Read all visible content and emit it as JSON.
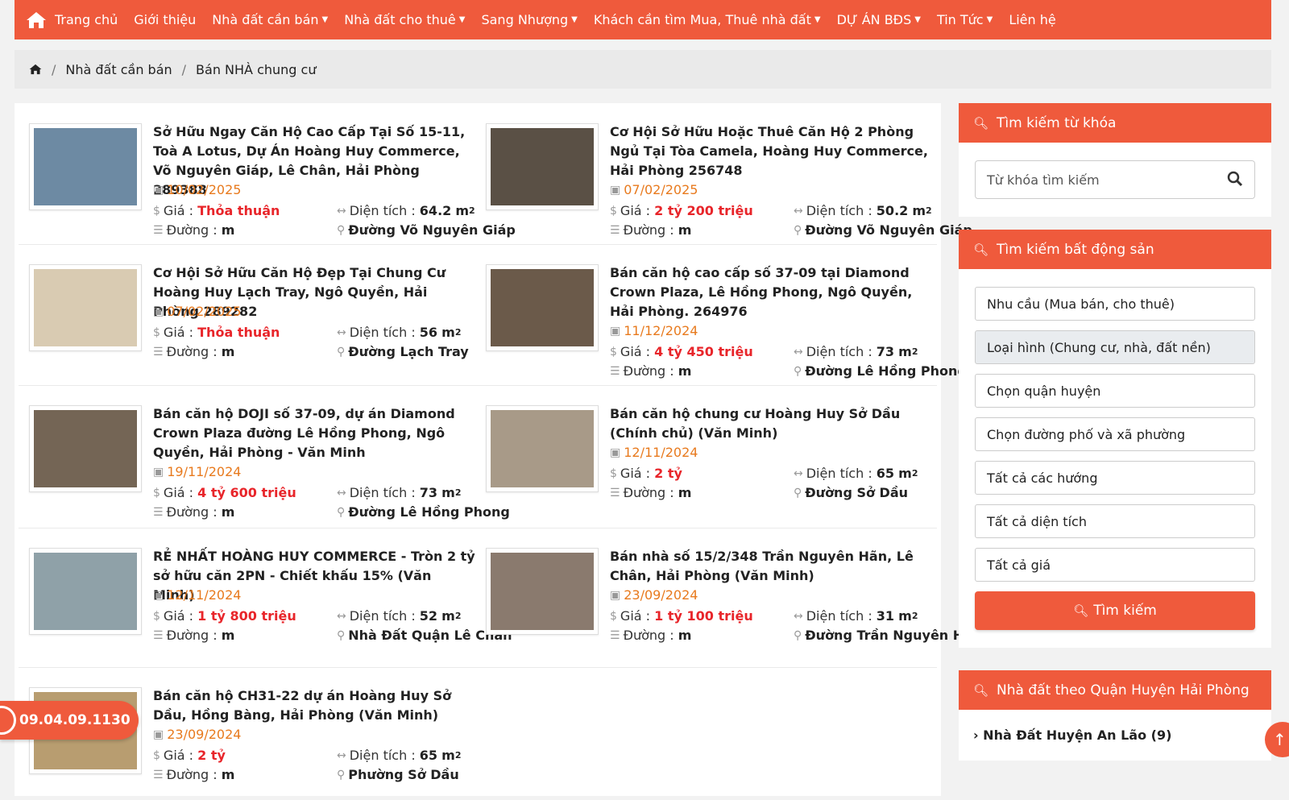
{
  "nav": {
    "items": [
      {
        "label": "Trang chủ",
        "caret": false
      },
      {
        "label": "Giới thiệu",
        "caret": false
      },
      {
        "label": "Nhà đất cần bán",
        "caret": true
      },
      {
        "label": "Nhà đất cho thuê",
        "caret": true
      },
      {
        "label": "Sang Nhượng",
        "caret": true
      },
      {
        "label": "Khách cần tìm Mua, Thuê nhà đất",
        "caret": true
      },
      {
        "label": "DỰ ÁN BĐS",
        "caret": true
      },
      {
        "label": "Tin Tức",
        "caret": true
      },
      {
        "label": "Liên hệ",
        "caret": false
      }
    ]
  },
  "breadcrumb": {
    "items": [
      "Nhà đất cần bán",
      "Bán NHÀ chung cư"
    ]
  },
  "labels": {
    "price": "Giá :",
    "area": "Diện tích :",
    "road": "Đường :",
    "road_value": "m",
    "area_unit": "m",
    "area_sup": "2"
  },
  "listings": [
    {
      "title": "Sở Hữu Ngay Căn Hộ Cao Cấp Tại Số 15-11, Toà A Lotus, Dự Án Hoàng Huy Commerce, Võ Nguyên Giáp, Lê Chân, Hải Phòng 289388",
      "date": "10/02/2025",
      "price": "Thỏa thuận",
      "area": "64.2",
      "location": "Đường Võ Nguyên Giáp",
      "thumb_color": "#6d8aa3"
    },
    {
      "title": "Cơ Hội Sở Hữu Hoặc Thuê Căn Hộ 2 Phòng Ngủ Tại Tòa Camela, Hoàng Huy Commerce, Hải Phòng 256748",
      "date": "07/02/2025",
      "price": "2 tỷ 200 triệu",
      "area": "50.2",
      "location": "Đường Võ Nguyên Giáp",
      "thumb_color": "#5a5045"
    },
    {
      "title": "Cơ Hội Sở Hữu Căn Hộ Đẹp Tại Chung Cư Hoàng Huy Lạch Tray, Ngô Quyền, Hải Phòng 289282",
      "date": "07/02/2025",
      "price": "Thỏa thuận",
      "area": "56",
      "location": "Đường Lạch Tray",
      "thumb_color": "#d9cbb2"
    },
    {
      "title": "Bán căn hộ cao cấp số 37-09 tại Diamond Crown Plaza, Lê Hồng Phong, Ngô Quyền, Hải Phòng. 264976",
      "date": "11/12/2024",
      "price": "4 tỷ 450 triệu",
      "area": "73",
      "location": "Đường Lê Hồng Phong",
      "thumb_color": "#6b5a4a"
    },
    {
      "title": "Bán căn hộ DOJI số 37-09, dự án Diamond Crown Plaza đường Lê Hồng Phong, Ngô Quyền, Hải Phòng - Văn Minh",
      "date": "19/11/2024",
      "price": "4 tỷ 600 triệu",
      "area": "73",
      "location": "Đường Lê Hồng Phong",
      "thumb_color": "#746555"
    },
    {
      "title": "Bán căn hộ chung cư Hoàng Huy Sở Dầu (Chính chủ) (Văn Minh)",
      "date": "12/11/2024",
      "price": "2 tỷ",
      "area": "65",
      "location": "Đường Sở Dầu",
      "thumb_color": "#a89a88"
    },
    {
      "title": "RẺ NHẤT HOÀNG HUY COMMERCE - Tròn 2 tỷ sở hữu căn 2PN - Chiết khấu 15% (Văn Minh)",
      "date": "12/11/2024",
      "price": "1 tỷ 800 triệu",
      "area": "52",
      "location": "Nhà Đất Quận Lê Chân",
      "thumb_color": "#8fa1a8"
    },
    {
      "title": "Bán nhà số 15/2/348 Trần Nguyên Hãn, Lê Chân, Hải Phòng (Văn Minh)",
      "date": "23/09/2024",
      "price": "1 tỷ 100 triệu",
      "area": "31",
      "location": "Đường Trần Nguyên Hãn",
      "thumb_color": "#8a7a6e"
    },
    {
      "title": "Bán căn hộ CH31-22 dự án Hoàng Huy Sở Dầu, Hồng Bàng, Hải Phòng (Văn Minh)",
      "date": "23/09/2024",
      "price": "2 tỷ",
      "area": "65",
      "location": "Phường Sở Dầu",
      "thumb_color": "#b89d70"
    }
  ],
  "sidebar": {
    "keyword_title": "Tìm kiếm từ khóa",
    "keyword_placeholder": "Từ khóa tìm kiếm",
    "filter_title": "Tìm kiếm bất động sản",
    "filters": [
      "Nhu cầu (Mua bán, cho thuê)",
      "Loại hình (Chung cư, nhà, đất nền)",
      "Chọn quận huyện",
      "Chọn đường phố và xã phường",
      "Tất cả các hướng",
      "Tất cả diện tích",
      "Tất cả giá"
    ],
    "search_button": "Tìm kiếm",
    "district_title": "Nhà đất theo Quận Huyện Hải Phòng",
    "district_first": "Nhà Đất Huyện An Lão (9)"
  },
  "phone": "09.04.09.1130",
  "colors": {
    "accent": "#ef5a3c",
    "price": "#e8252a",
    "date": "#e87a1e"
  }
}
